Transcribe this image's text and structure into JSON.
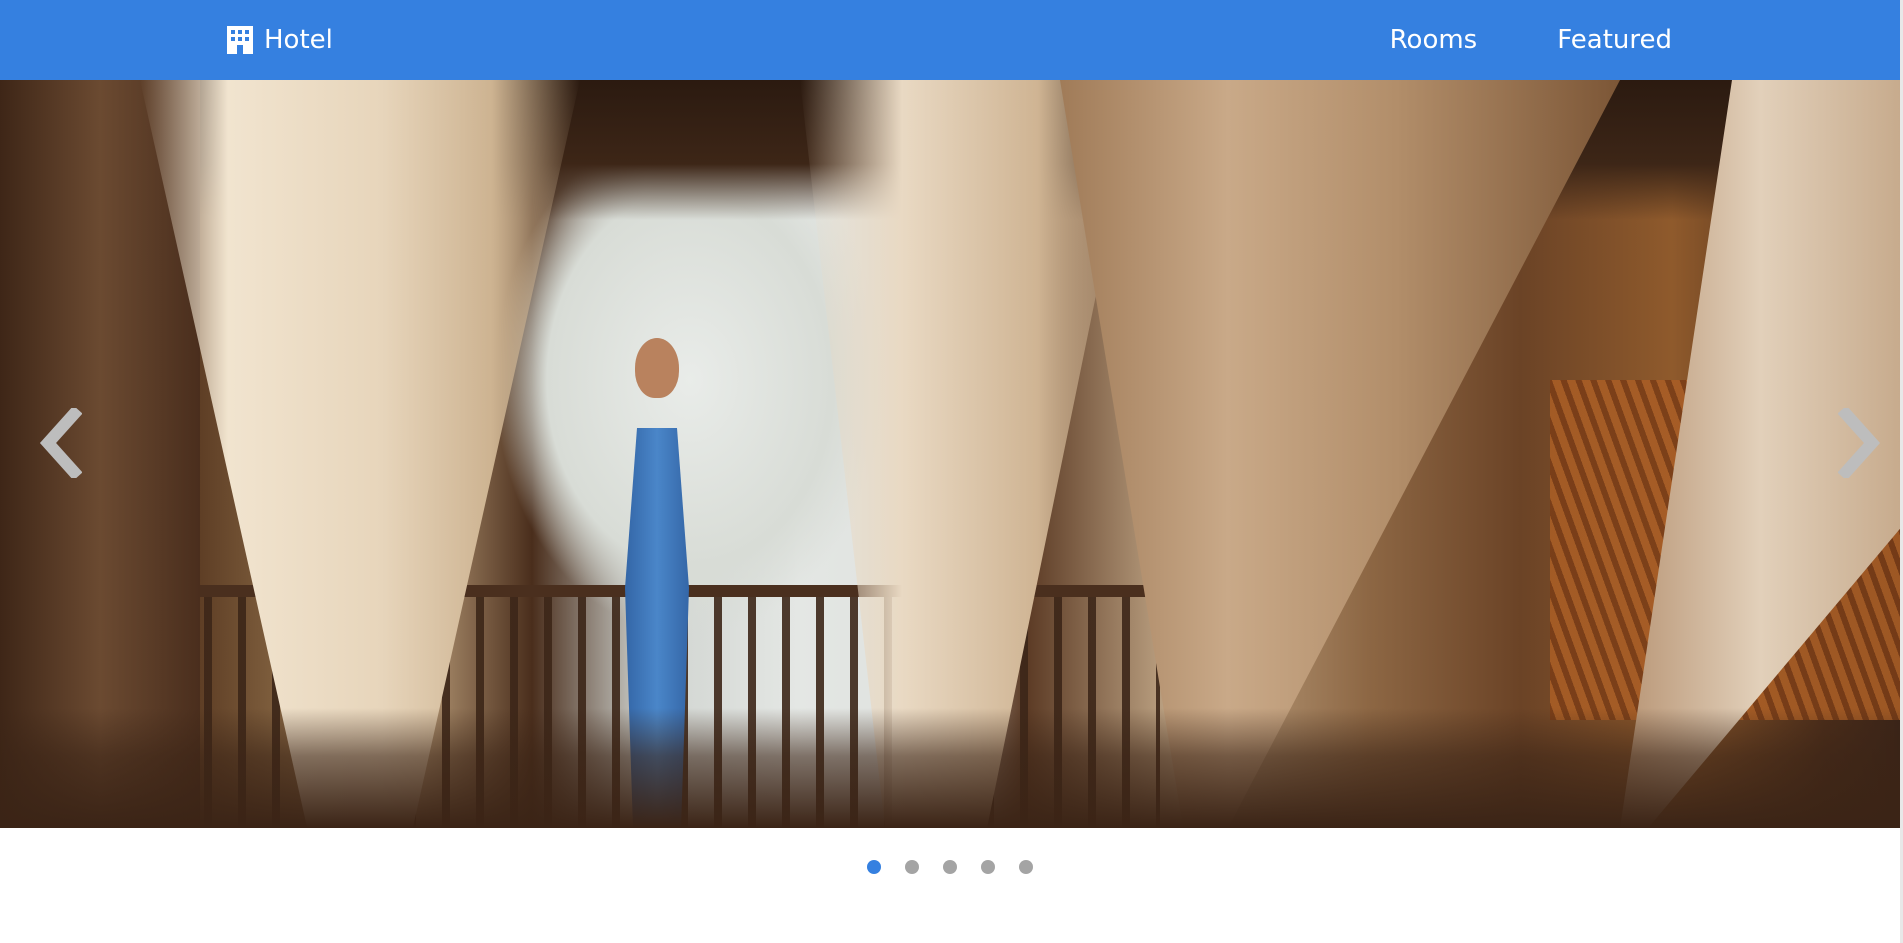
{
  "navbar": {
    "brand_icon": "hotel-building-icon",
    "brand_label": "Hotel",
    "links": [
      "Rooms",
      "Featured"
    ],
    "background_color": "#3580e0"
  },
  "carousel": {
    "prev_icon": "chevron-left-icon",
    "next_icon": "chevron-right-icon",
    "slide_count": 5,
    "active_index": 0,
    "indicator_active_color": "#3580e0",
    "indicator_inactive_color": "#a4a4a4"
  }
}
